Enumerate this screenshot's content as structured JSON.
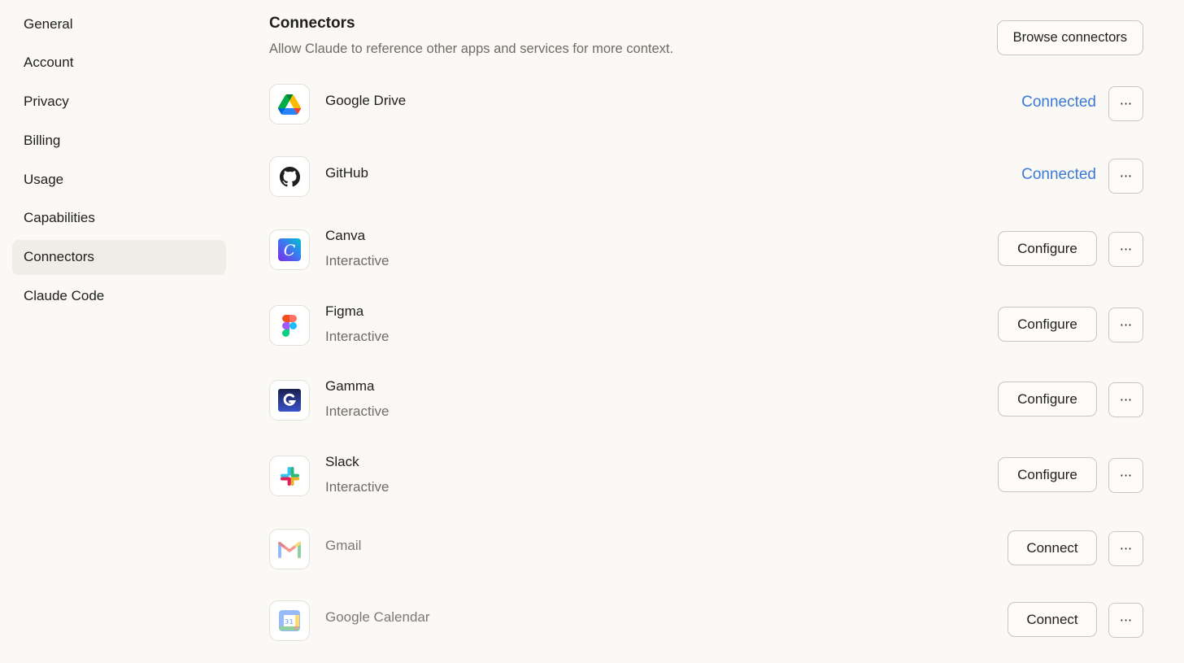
{
  "sidebar": {
    "items": [
      {
        "label": "General"
      },
      {
        "label": "Account"
      },
      {
        "label": "Privacy"
      },
      {
        "label": "Billing"
      },
      {
        "label": "Usage"
      },
      {
        "label": "Capabilities"
      },
      {
        "label": "Connectors",
        "active": true
      },
      {
        "label": "Claude Code"
      }
    ]
  },
  "header": {
    "title": "Connectors",
    "subtitle": "Allow Claude to reference other apps and services for more context.",
    "browse_label": "Browse connectors"
  },
  "more_label": "···",
  "connectors": [
    {
      "name": "Google Drive",
      "icon": "google-drive-icon",
      "status": "Connected"
    },
    {
      "name": "GitHub",
      "icon": "github-icon",
      "status": "Connected"
    },
    {
      "name": "Canva",
      "icon": "canva-icon",
      "subtitle": "Interactive",
      "action": "Configure"
    },
    {
      "name": "Figma",
      "icon": "figma-icon",
      "subtitle": "Interactive",
      "action": "Configure"
    },
    {
      "name": "Gamma",
      "icon": "gamma-icon",
      "subtitle": "Interactive",
      "action": "Configure"
    },
    {
      "name": "Slack",
      "icon": "slack-icon",
      "subtitle": "Interactive",
      "action": "Configure"
    },
    {
      "name": "Gmail",
      "icon": "gmail-icon",
      "action": "Connect"
    },
    {
      "name": "Google Calendar",
      "icon": "google-calendar-icon",
      "action": "Connect",
      "calendar_day": "31"
    }
  ],
  "colors": {
    "background": "#faf9f5",
    "active_nav": "#efede6",
    "connected_link": "#3b7ad9",
    "border": "#c9c6bd"
  }
}
